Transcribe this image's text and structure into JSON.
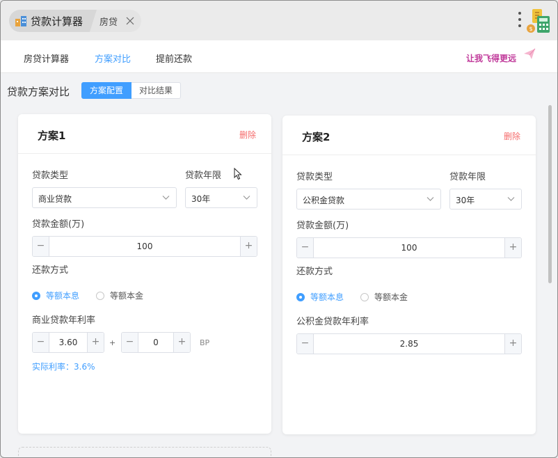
{
  "titlebar": {
    "app_tab_label": "贷款计算器",
    "sub_tab_label": "房贷"
  },
  "nav": {
    "items": [
      {
        "label": "房贷计算器",
        "active": false
      },
      {
        "label": "方案对比",
        "active": true
      },
      {
        "label": "提前还款",
        "active": false
      }
    ],
    "promo": "让我飞得更远"
  },
  "section": {
    "title": "贷款方案对比",
    "segments": [
      {
        "label": "方案配置",
        "active": true
      },
      {
        "label": "对比结果",
        "active": false
      }
    ]
  },
  "plans": [
    {
      "title": "方案1",
      "delete_label": "删除",
      "loan_type_label": "贷款类型",
      "loan_type_value": "商业贷款",
      "term_label": "贷款年限",
      "term_value": "30年",
      "amount_label": "贷款金额(万)",
      "amount_value": "100",
      "repay_label": "还款方式",
      "repay_options": [
        "等额本息",
        "等额本金"
      ],
      "repay_selected": "等额本息",
      "rate_label": "商业贷款年利率",
      "rate_value": "3.60",
      "rate_plus": "+",
      "bp_value": "0",
      "bp_unit": "BP",
      "actual_rate": "实际利率：3.6%"
    },
    {
      "title": "方案2",
      "delete_label": "删除",
      "loan_type_label": "贷款类型",
      "loan_type_value": "公积金贷款",
      "term_label": "贷款年限",
      "term_value": "30年",
      "amount_label": "贷款金额(万)",
      "amount_value": "100",
      "repay_label": "还款方式",
      "repay_options": [
        "等额本息",
        "等额本金"
      ],
      "repay_selected": "等额本息",
      "rate_label": "公积金贷款年利率",
      "rate_value": "2.85"
    }
  ],
  "stepper_symbols": {
    "minus": "−",
    "plus": "+"
  },
  "colors": {
    "accent": "#409eff",
    "danger": "#f56c6c",
    "promo": "#c0399a"
  }
}
